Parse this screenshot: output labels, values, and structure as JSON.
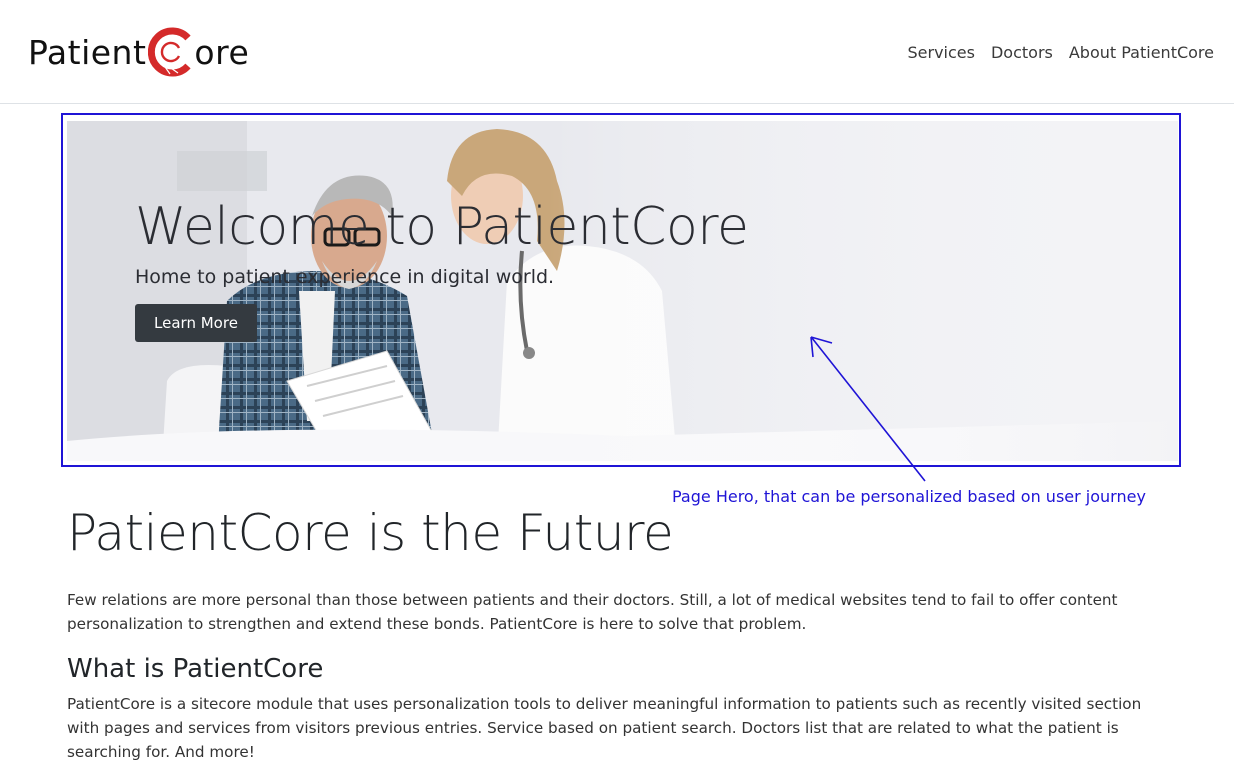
{
  "brand": {
    "name_prefix": "Patient",
    "name_c": "C",
    "name_suffix": "ore",
    "accent_color": "#d42a2a"
  },
  "nav": {
    "items": [
      {
        "label": "Services"
      },
      {
        "label": "Doctors"
      },
      {
        "label": "About PatientCore"
      }
    ]
  },
  "hero": {
    "title": "Welcome to PatientCore",
    "subtitle": "Home to patient experience in digital world.",
    "cta_label": "Learn More",
    "outline_color": "#1f14d6"
  },
  "annotation": {
    "label": "Page Hero, that can be personalized based on user journey",
    "color": "#1f14d6"
  },
  "content": {
    "heading": "PatientCore is the Future",
    "intro": "Few relations are more personal than those between patients and their doctors. Still, a lot of medical websites tend to fail to offer content personalization to strengthen and extend these bonds. PatientCore is here to solve that problem.",
    "subheading": "What is PatientCore",
    "body": "PatientCore is a sitecore module that uses personalization tools to deliver meaningful information to patients such as recently visited section with pages and services from visitors previous entries. Service based on patient search. Doctors list that are related to what the patient is searching for. And more!"
  },
  "icons": {
    "logo": "patientcore-logo-icon",
    "annotation_arrow": "arrow-icon"
  }
}
